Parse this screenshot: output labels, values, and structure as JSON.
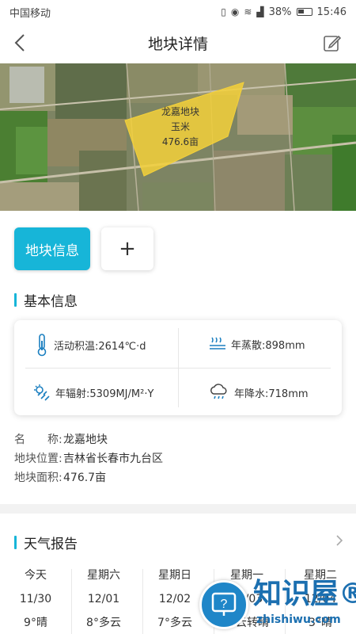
{
  "status_bar": {
    "carrier": "中国移动",
    "battery": "38%",
    "time": "15:46"
  },
  "header": {
    "title": "地块详情"
  },
  "map": {
    "plot_name": "龙嘉地块",
    "crop": "玉米",
    "area": "476.6亩"
  },
  "tabs": {
    "active_label": "地块信息",
    "add_label": "+"
  },
  "basic_info": {
    "section_title": "基本信息",
    "accumulated_temp": "活动积温:2614℃·d",
    "evaporation": "年蒸散:898mm",
    "radiation": "年辐射:5309MJ/M²·Y",
    "precipitation": "年降水:718mm"
  },
  "plot_details": {
    "name_key": "名　　称:",
    "name_value": "龙嘉地块",
    "location_key": "地块位置:",
    "location_value": "吉林省长春市九台区",
    "area_key": "地块面积:",
    "area_value": "476.7亩"
  },
  "weather": {
    "section_title": "天气报告",
    "days": [
      {
        "day": "今天",
        "date": "11/30",
        "condition": "9°晴"
      },
      {
        "day": "星期六",
        "date": "12/01",
        "condition": "8°多云"
      },
      {
        "day": "星期日",
        "date": "12/02",
        "condition": "7°多云"
      },
      {
        "day": "星期一",
        "date": "12/03",
        "condition": "多云转晴"
      },
      {
        "day": "星期二",
        "date": "12/04",
        "condition": "3°晴"
      }
    ]
  },
  "watermark": {
    "text": "知识屋®",
    "sub": "zhishiwu.com"
  },
  "colors": {
    "accent": "#17b5d8",
    "plot_fill": "#f3d03a"
  }
}
